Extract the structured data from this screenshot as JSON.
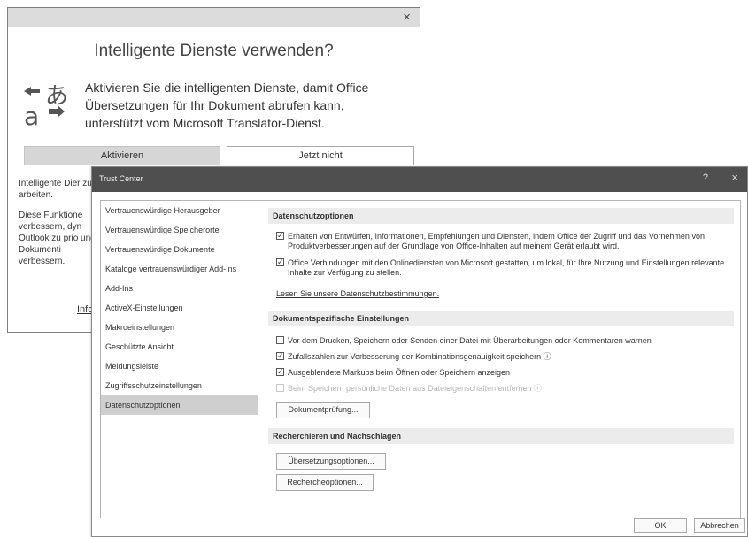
{
  "smart_services_dialog": {
    "close": "×",
    "title": "Intelligente Dienste verwenden?",
    "message": "Aktivieren Sie die intelligenten Dienste, damit Office Übersetzungen für Ihr Dokument abrufen kann, unterstützt vom Microsoft Translator-Dienst.",
    "activate_label": "Aktivieren",
    "not_now_label": "Jetzt nicht",
    "para1": "Intelligente Dier zu arbeiten.",
    "para2": "Diese Funktione verbessern, dyn Outlook zu prio und Dokumenti verbessern.",
    "more_link": "Info",
    "icon": "translate-icon"
  },
  "trust_center": {
    "title": "Trust Center",
    "help": "?",
    "close": "×",
    "nav": [
      "Vertrauenswürdige Herausgeber",
      "Vertrauenswürdige Speicherorte",
      "Vertrauenswürdige Dokumente",
      "Kataloge vertrauenswürdiger Add-Ins",
      "Add-Ins",
      "ActiveX-Einstellungen",
      "Makroeinstellungen",
      "Geschützte Ansicht",
      "Meldungsleiste",
      "Zugriffsschutzeinstellungen",
      "Datenschutzoptionen"
    ],
    "selected_nav": "Datenschutzoptionen",
    "privacy": {
      "header": "Datenschutzoptionen",
      "opt1": "Erhalten von Entwürfen, Informationen, Empfehlungen und Diensten, indem Office der Zugriff und das Vornehmen von Produktverbesserungen auf der Grundlage von Office-Inhalten auf meinem Gerät erlaubt wird.",
      "opt1_checked": true,
      "opt2": "Office Verbindungen mit den Onlinediensten von Microsoft gestatten, um lokal, für Ihre Nutzung und Einstellungen relevante Inhalte zur Verfügung zu stellen.",
      "opt2_checked": true,
      "privacy_link": "Lesen Sie unsere Datenschutzbestimmungen."
    },
    "document": {
      "header": "Dokumentspezifische Einstellungen",
      "opt1": "Vor dem Drucken, Speichern oder Senden einer Datei mit Überarbeitungen oder Kommentaren warnen",
      "opt1_checked": false,
      "opt2": "Zufallszahlen zur Verbesserung der Kombinationsgenauigkeit speichern ⓘ",
      "opt2_checked": true,
      "opt3": "Ausgeblendete Markups beim Öffnen oder Speichern anzeigen",
      "opt3_checked": true,
      "opt4": "Beim Speichern persönliche Daten aus Dateieigenschaften entfernen ⓘ",
      "opt4_checked": false,
      "inspect_button": "Dokumentprüfung..."
    },
    "research": {
      "header": "Recherchieren und Nachschlagen",
      "translation_button": "Übersetzungsoptionen...",
      "research_button": "Rechercheoptionen..."
    },
    "ok_label": "OK",
    "cancel_label": "Abbrechen"
  }
}
